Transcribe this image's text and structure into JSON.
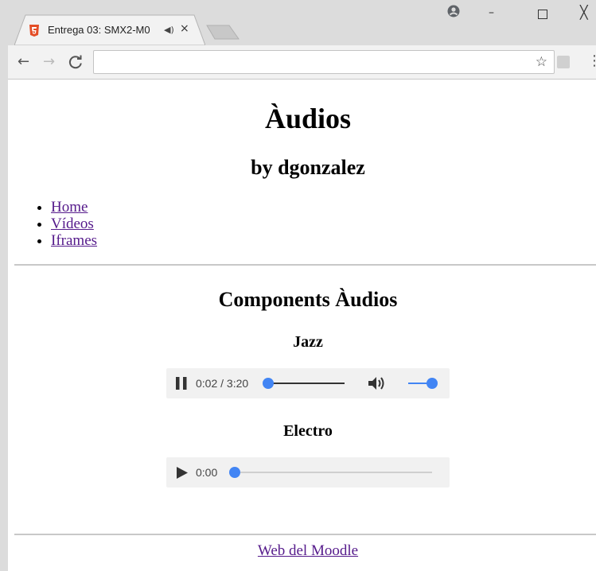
{
  "browser": {
    "tab_title": "Entrega 03: SMX2-M0",
    "tab_audio_icon": "speaker-icon",
    "tab_close": "×",
    "address_value": "",
    "window_min": "–",
    "window_close": "╳",
    "back_glyph": "←",
    "forward_glyph": "→",
    "reload_glyph": "C",
    "star_glyph": "☆",
    "menu_glyph": "⋮"
  },
  "page": {
    "title": "Àudios",
    "author": "by dgonzalez",
    "nav": [
      {
        "label": "Home"
      },
      {
        "label": "Vídeos"
      },
      {
        "label": "Iframes"
      }
    ],
    "section_title": "Components Àudios",
    "audios": [
      {
        "title": "Jazz",
        "time": "0:02 / 3:20",
        "state": "playing",
        "progress": 0.01,
        "volume": 1.0
      },
      {
        "title": "Electro",
        "time": "0:00",
        "state": "paused",
        "progress": 0.0
      }
    ],
    "footer_link": "Web del Moodle"
  },
  "colors": {
    "link": "#551a8b",
    "accent": "#4285f4",
    "player_bg": "#f1f1f1",
    "chrome_bg": "#dcdcdc"
  }
}
